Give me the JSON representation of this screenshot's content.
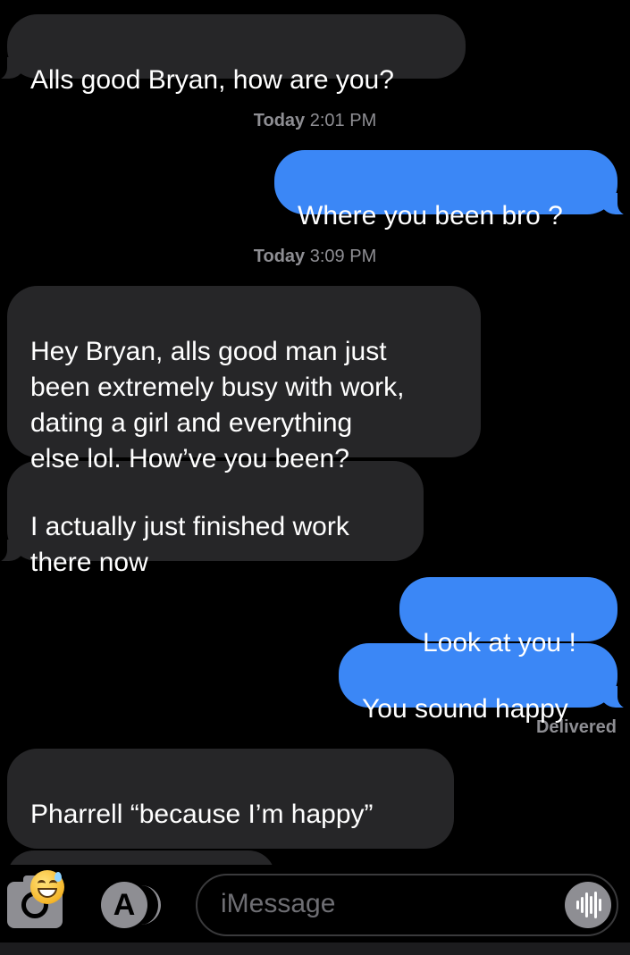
{
  "messages": {
    "m1": "Alls good Bryan, how are you?",
    "m2": "Where you been bro ?",
    "m3": "Hey Bryan, alls good man just\nbeen extremely busy with work,\ndating a girl and everything\nelse lol. How’ve you been?",
    "m4": "I actually just finished work\nthere now",
    "m5": "Look at you !",
    "m6": "You sound happy",
    "m7": "Pharrell “because I’m happy”"
  },
  "timestamps": {
    "t1_day": "Today",
    "t1_time": "2:01 PM",
    "t2_day": "Today",
    "t2_time": "3:09 PM"
  },
  "status": {
    "delivered": "Delivered"
  },
  "compose": {
    "placeholder": "iMessage"
  },
  "icons": {
    "camera": "camera-icon",
    "appstore": "app-store-icon",
    "audio": "audio-waveform-icon",
    "emoji": "grinning-face-with-sweat-emoji"
  },
  "colors": {
    "incoming_bubble": "#262628",
    "outgoing_bubble": "#3b87f6",
    "background": "#000000",
    "timestamp": "#8e8e93"
  }
}
